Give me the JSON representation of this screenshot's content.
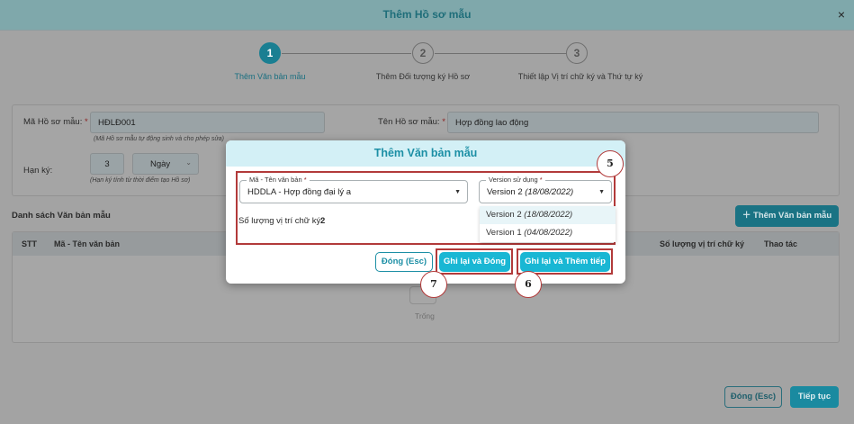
{
  "page": {
    "title": "Thêm Hồ sơ mẫu",
    "close_symbol": "×"
  },
  "steps": [
    {
      "number": "1",
      "label": "Thêm Văn bản mẫu"
    },
    {
      "number": "2",
      "label": "Thêm Đối tượng ký Hồ sơ"
    },
    {
      "number": "3",
      "label": "Thiết lập Vị trí chữ ký và Thứ tự ký"
    }
  ],
  "form": {
    "ma_ho_so_label": "Mã Hồ sơ mẫu:",
    "ma_ho_so_value": "HĐLĐ001",
    "ma_ho_so_hint": "(Mã Hồ sơ mẫu tự động sinh và cho phép sửa)",
    "ten_ho_so_label": "Tên Hồ sơ mẫu:",
    "ten_ho_so_value": "Hợp đồng lao động",
    "han_ky_label": "Hạn ký:",
    "han_ky_value": "3",
    "han_ky_unit": "Ngày",
    "han_ky_hint": "(Hạn ký tính từ thời điểm tạo Hồ sơ)",
    "required_mark": "*"
  },
  "list": {
    "title": "Danh sách Văn bản mẫu",
    "add_button": "Thêm Văn bản mẫu",
    "columns": [
      "STT",
      "Mã - Tên văn bản",
      "Số lượng vị trí chữ ký",
      "Thao tác"
    ],
    "empty_text": "Trống"
  },
  "footer": {
    "close_button": "Đóng (Esc)",
    "next_button": "Tiếp tục"
  },
  "modal": {
    "title": "Thêm Văn bản mẫu",
    "doc_field_label": "Mã - Tên văn bản",
    "doc_field_value": "HDDLA - Hợp đồng đại lý a",
    "version_field_label": "Version sử dụng",
    "version_field_value": "Version 2",
    "version_field_date": "(18/08/2022)",
    "sig_count_label": "Số lượng vị trí chữ ký:",
    "sig_count_value": "2",
    "versions": [
      {
        "name": "Version 2",
        "date": "(18/08/2022)"
      },
      {
        "name": "Version 1",
        "date": "(04/08/2022)"
      }
    ],
    "close_button": "Đóng (Esc)",
    "save_close_button": "Ghi lại và Đóng",
    "save_more_button": "Ghi lại và Thêm tiếp"
  },
  "callouts": [
    "5",
    "6",
    "7"
  ],
  "colors": {
    "accent": "#1c8fa5",
    "button_fill": "#19b7d4",
    "highlight_red": "#b23a3a"
  }
}
